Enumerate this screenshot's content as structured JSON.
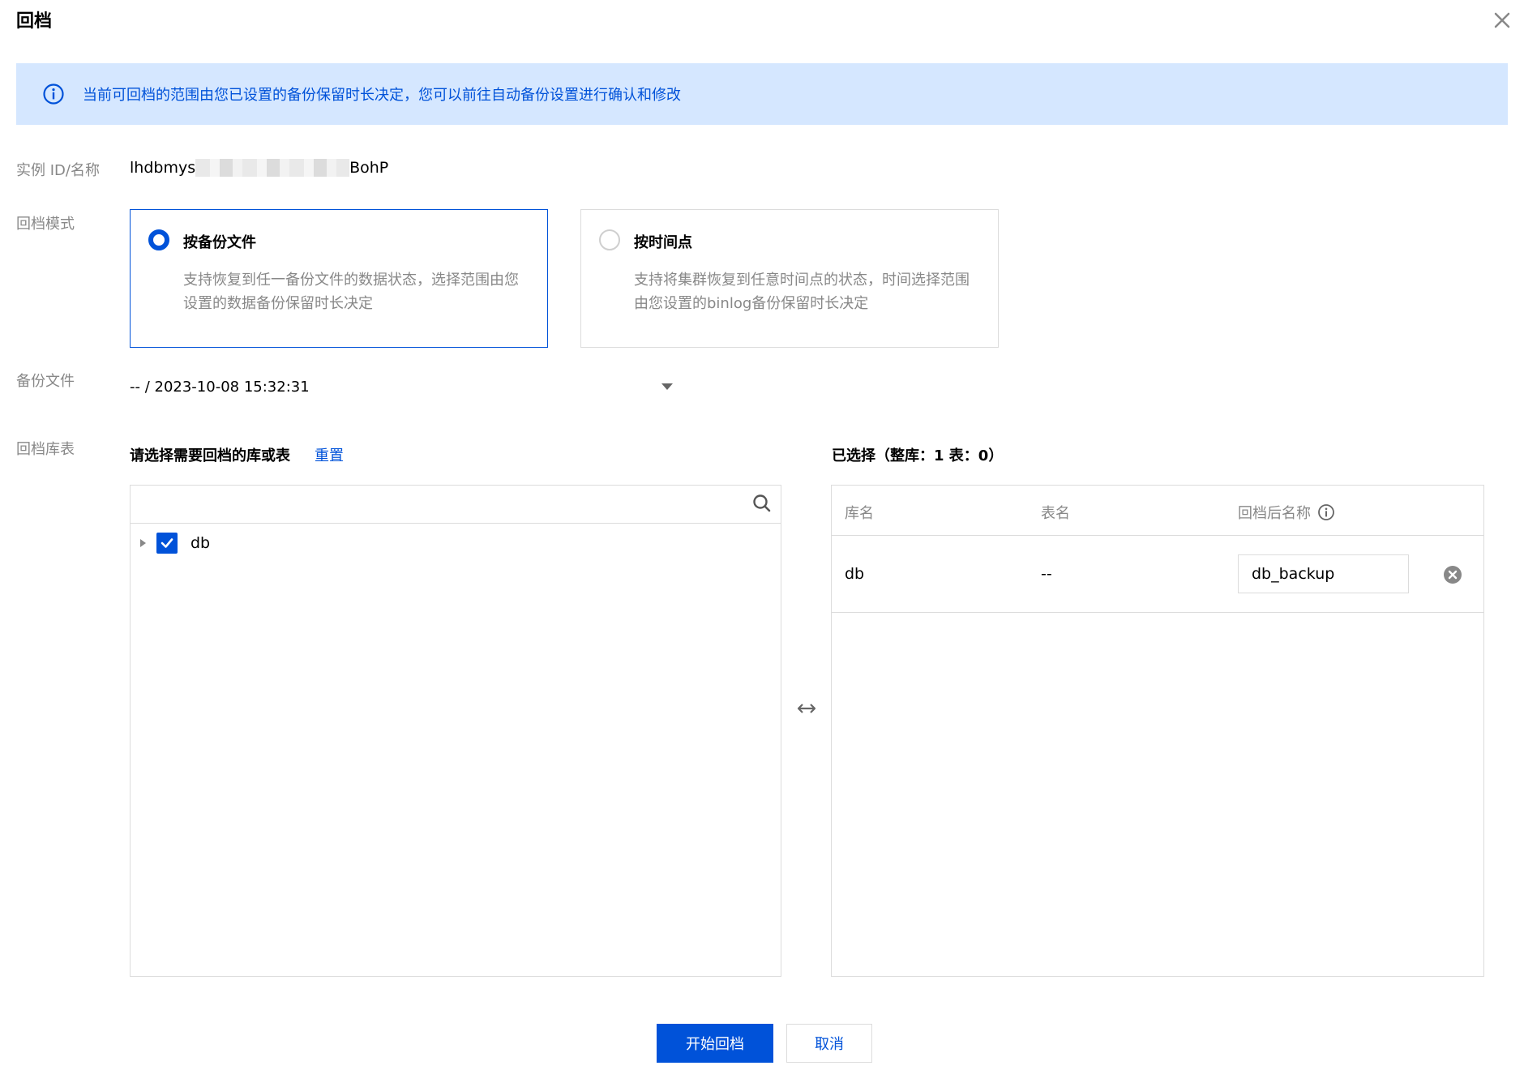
{
  "dialog": {
    "title": "回档"
  },
  "notice": {
    "text": "当前可回档的范围由您已设置的备份保留时长决定，您可以前往自动备份设置进行确认和修改"
  },
  "form": {
    "instance_label": "实例 ID/名称",
    "instance_prefix": "lhdbmys",
    "instance_suffix": "BohP",
    "mode_label": "回档模式",
    "backup_label": "备份文件",
    "tables_label": "回档库表"
  },
  "modes": [
    {
      "title": "按备份文件",
      "desc": "支持恢复到任一备份文件的数据状态，选择范围由您设置的数据备份保留时长决定",
      "selected": true
    },
    {
      "title": "按时间点",
      "desc": "支持将集群恢复到任意时间点的状态，时间选择范围由您设置的binlog备份保留时长决定",
      "selected": false
    }
  ],
  "backup_select": {
    "value": "-- / 2023-10-08 15:32:31"
  },
  "source_panel": {
    "heading": "请选择需要回档的库或表",
    "reset_label": "重置",
    "search_placeholder": "",
    "tree": [
      {
        "label": "db",
        "checked": true
      }
    ]
  },
  "selected_panel": {
    "heading": "已选择（整库：1 表：0）",
    "columns": [
      "库名",
      "表名",
      "回档后名称"
    ],
    "rows": [
      {
        "db": "db",
        "table": "--",
        "rename": "db_backup"
      }
    ]
  },
  "footer": {
    "confirm_label": "开始回档",
    "cancel_label": "取消"
  },
  "colors": {
    "primary": "#0052d9",
    "notice_bg": "#d5e7ff",
    "label_gray": "#888888",
    "border": "#dcdcdc"
  },
  "icons": [
    "close-icon",
    "info-icon",
    "chevron-down-icon",
    "search-icon",
    "caret-right-icon",
    "check-icon",
    "transfer-icon",
    "info-circle-icon",
    "remove-circle-icon"
  ]
}
